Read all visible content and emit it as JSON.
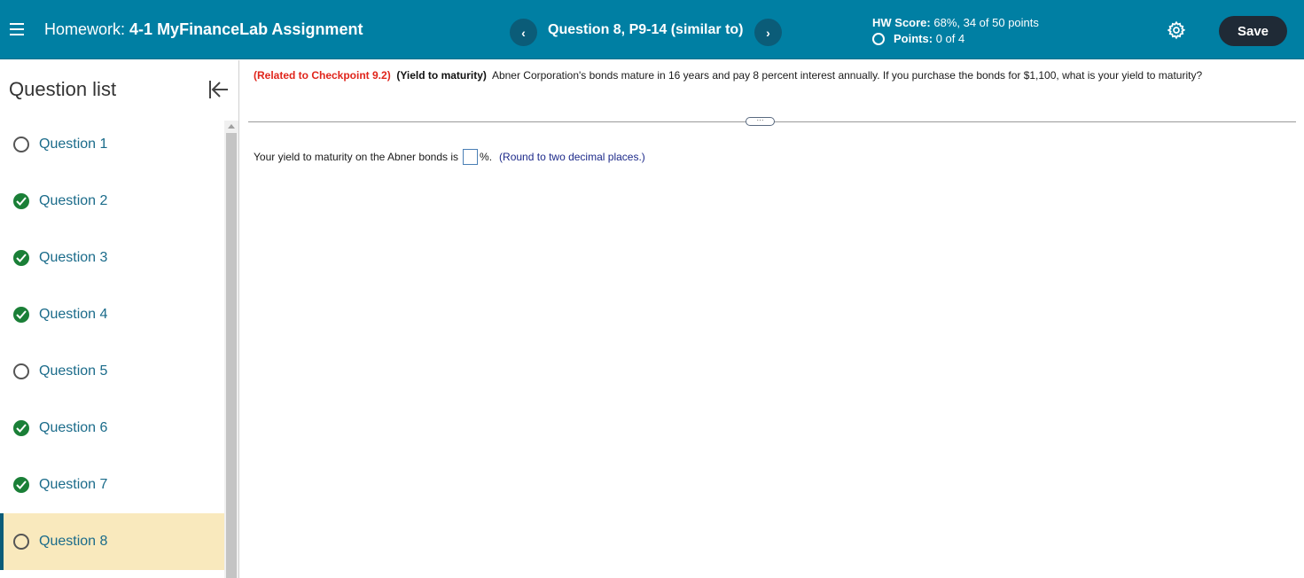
{
  "header": {
    "title_prefix": "Homework:",
    "title_name": "4-1 MyFinanceLab Assignment",
    "prev_label": "‹",
    "next_label": "›",
    "question_title": "Question 8, P9-14 (similar to)",
    "hw_score_label": "HW Score:",
    "hw_score_value": "68%, 34 of 50 points",
    "points_label": "Points:",
    "points_value": "0 of 4",
    "save_label": "Save"
  },
  "sidebar": {
    "title": "Question list",
    "items": [
      {
        "label": "Question 1",
        "status": "open"
      },
      {
        "label": "Question 2",
        "status": "done"
      },
      {
        "label": "Question 3",
        "status": "done"
      },
      {
        "label": "Question 4",
        "status": "done"
      },
      {
        "label": "Question 5",
        "status": "open"
      },
      {
        "label": "Question 6",
        "status": "done"
      },
      {
        "label": "Question 7",
        "status": "done"
      },
      {
        "label": "Question 8",
        "status": "open",
        "active": true
      }
    ]
  },
  "question": {
    "related": "(Related to Checkpoint 9.2)",
    "topic": "(Yield to maturity)",
    "body": "Abner Corporation's bonds mature in 16 years and pay 8 percent interest annually.  If you purchase the bonds for $1,100, what is your yield to maturity?",
    "answer_prefix": "Your yield to maturity on the Abner bonds is",
    "answer_suffix": "%.",
    "hint": "(Round to two decimal places.)",
    "divider_handle": "···"
  },
  "colors": {
    "header_bg": "#007fa3",
    "save_bg": "#1f2a36",
    "active_item_bg": "#f9e9bd",
    "done_green": "#1a7f37",
    "related_red": "#e0251b"
  }
}
